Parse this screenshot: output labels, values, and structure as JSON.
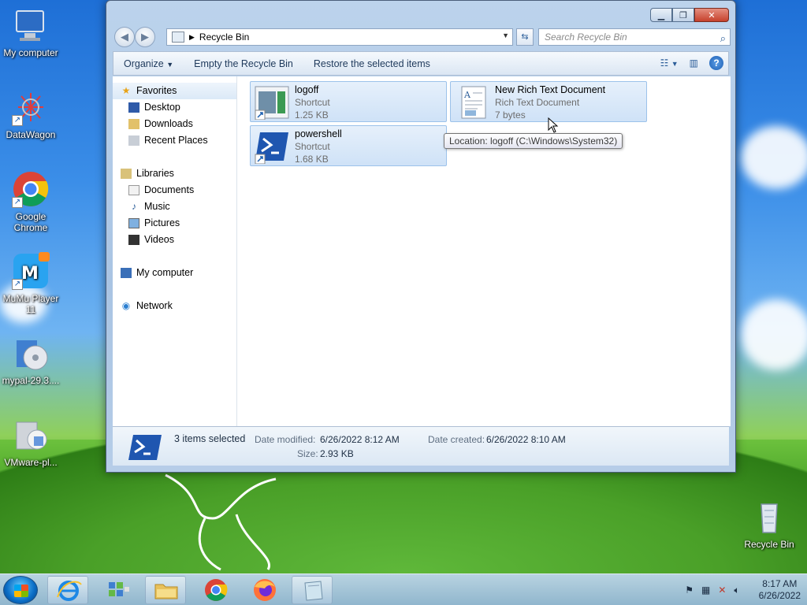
{
  "desktop": {
    "icons": [
      {
        "label": "My computer"
      },
      {
        "label": "DataWagon"
      },
      {
        "label": "Google Chrome"
      },
      {
        "label": "MuMu Player 11"
      },
      {
        "label": "mypal-29.3...."
      },
      {
        "label": "VMware-pl..."
      },
      {
        "label": "Recycle Bin"
      }
    ]
  },
  "window": {
    "address": "Recycle Bin",
    "search_placeholder": "Search Recycle Bin",
    "toolbar": {
      "organize": "Organize",
      "empty": "Empty the Recycle Bin",
      "restore": "Restore the selected items"
    },
    "nav": {
      "favorites": "Favorites",
      "desktop": "Desktop",
      "downloads": "Downloads",
      "recent": "Recent Places",
      "libraries": "Libraries",
      "documents": "Documents",
      "music": "Music",
      "pictures": "Pictures",
      "videos": "Videos",
      "computer": "My computer",
      "network": "Network"
    },
    "items": [
      {
        "name": "logoff",
        "type": "Shortcut",
        "size": "1.25 KB"
      },
      {
        "name": "New Rich Text Document",
        "type": "Rich Text Document",
        "size": "7 bytes"
      },
      {
        "name": "powershell",
        "type": "Shortcut",
        "size": "1.68 KB"
      }
    ],
    "tooltip": "Location: logoff (C:\\Windows\\System32)",
    "details": {
      "selected": "3 items selected",
      "date_modified_label": "Date modified:",
      "date_modified": "6/26/2022 8:12 AM",
      "date_created_label": "Date created:",
      "date_created": "6/26/2022 8:10 AM",
      "size_label": "Size:",
      "size": "2.93 KB"
    }
  },
  "taskbar": {
    "time": "8:17 AM",
    "date": "6/26/2022"
  },
  "colors": {
    "accent": "#1e395b",
    "selection": "#cfe2f7",
    "powershell": "#1f56b0"
  }
}
